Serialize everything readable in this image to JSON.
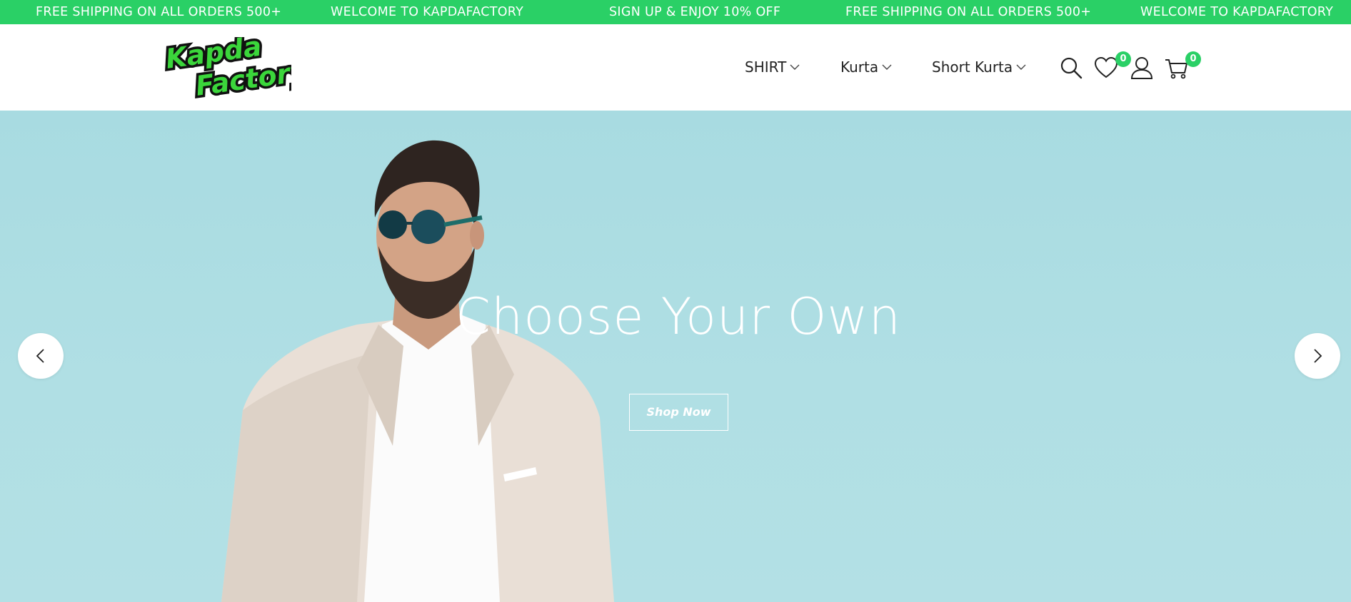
{
  "colors": {
    "accent": "#2ad066",
    "hero_background": "#b0dfe4",
    "text_dark": "#222222"
  },
  "announcement": {
    "messages": [
      "FREE SHIPPING ON ALL ORDERS 500+",
      "WELCOME TO KAPDAFACTORY",
      "SIGN UP & ENJOY 10% OFF",
      "FREE SHIPPING ON ALL ORDERS 500+",
      "WELCOME TO KAPDAFACTORY"
    ]
  },
  "header": {
    "logo": {
      "line1": "Kapda",
      "line2": "Factory"
    },
    "nav": [
      {
        "label": "SHIRT",
        "icon": "chevron-down-icon"
      },
      {
        "label": "Kurta",
        "icon": "chevron-down-icon"
      },
      {
        "label": "Short Kurta",
        "icon": "chevron-down-icon"
      }
    ],
    "icons": {
      "search": "search-icon",
      "wishlist": "heart-icon",
      "account": "user-icon",
      "cart": "cart-icon"
    },
    "wishlist_count": "0",
    "cart_count": "0"
  },
  "hero": {
    "title": "Choose Your Own",
    "button_label": "Shop Now",
    "prev_icon": "chevron-left-icon",
    "next_icon": "chevron-right-icon"
  }
}
